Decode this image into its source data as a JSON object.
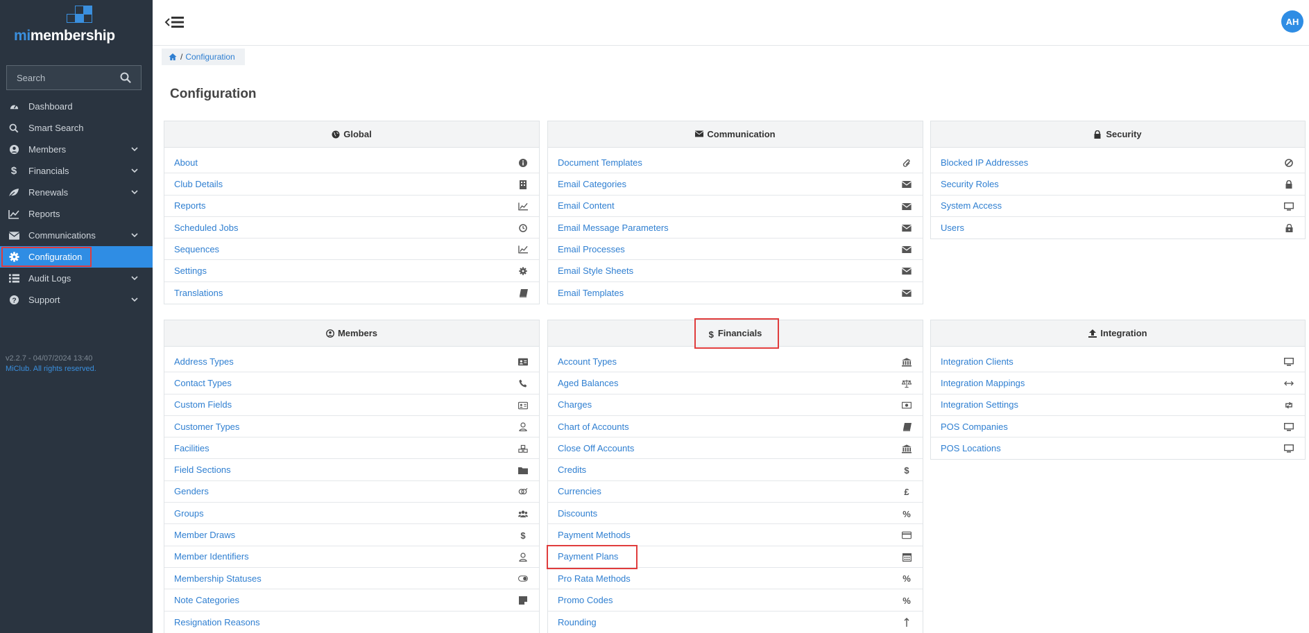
{
  "app": {
    "logo_prefix": "mi",
    "logo_suffix": "membership"
  },
  "search": {
    "placeholder": "Search"
  },
  "sidebar": {
    "items": [
      {
        "label": "Dashboard"
      },
      {
        "label": "Smart Search"
      },
      {
        "label": "Members"
      },
      {
        "label": "Financials"
      },
      {
        "label": "Renewals"
      },
      {
        "label": "Reports"
      },
      {
        "label": "Communications"
      },
      {
        "label": "Configuration"
      },
      {
        "label": "Audit Logs"
      },
      {
        "label": "Support"
      }
    ],
    "version": "v2.2.7 - 04/07/2024 13:40",
    "copyright": "MiClub. All rights reserved."
  },
  "user": {
    "initials": "AH"
  },
  "breadcrumb": {
    "separator": "/",
    "current": "Configuration"
  },
  "page": {
    "title": "Configuration"
  },
  "panels": {
    "global": {
      "title": "Global",
      "items": [
        "About",
        "Club Details",
        "Reports",
        "Scheduled Jobs",
        "Sequences",
        "Settings",
        "Translations"
      ]
    },
    "communication": {
      "title": "Communication",
      "items": [
        "Document Templates",
        "Email Categories",
        "Email Content",
        "Email Message Parameters",
        "Email Processes",
        "Email Style Sheets",
        "Email Templates"
      ]
    },
    "security": {
      "title": "Security",
      "items": [
        "Blocked IP Addresses",
        "Security Roles",
        "System Access",
        "Users"
      ]
    },
    "members": {
      "title": "Members",
      "items": [
        "Address Types",
        "Contact Types",
        "Custom Fields",
        "Customer Types",
        "Facilities",
        "Field Sections",
        "Genders",
        "Groups",
        "Member Draws",
        "Member Identifiers",
        "Membership Statuses",
        "Note Categories",
        "Resignation Reasons"
      ]
    },
    "financials": {
      "title": "Financials",
      "items": [
        "Account Types",
        "Aged Balances",
        "Charges",
        "Chart of Accounts",
        "Close Off Accounts",
        "Credits",
        "Currencies",
        "Discounts",
        "Payment Methods",
        "Payment Plans",
        "Pro Rata Methods",
        "Promo Codes",
        "Rounding"
      ]
    },
    "integration": {
      "title": "Integration",
      "items": [
        "Integration Clients",
        "Integration Mappings",
        "Integration Settings",
        "POS Companies",
        "POS Locations"
      ]
    }
  },
  "icon_glyphs": {
    "dollar": "$",
    "pound": "£",
    "percent": "%"
  },
  "colors": {
    "accent": "#2f8de4",
    "sidebar": "#2a3440",
    "link": "#2f7fd1",
    "highlight": "#e03c3c"
  }
}
